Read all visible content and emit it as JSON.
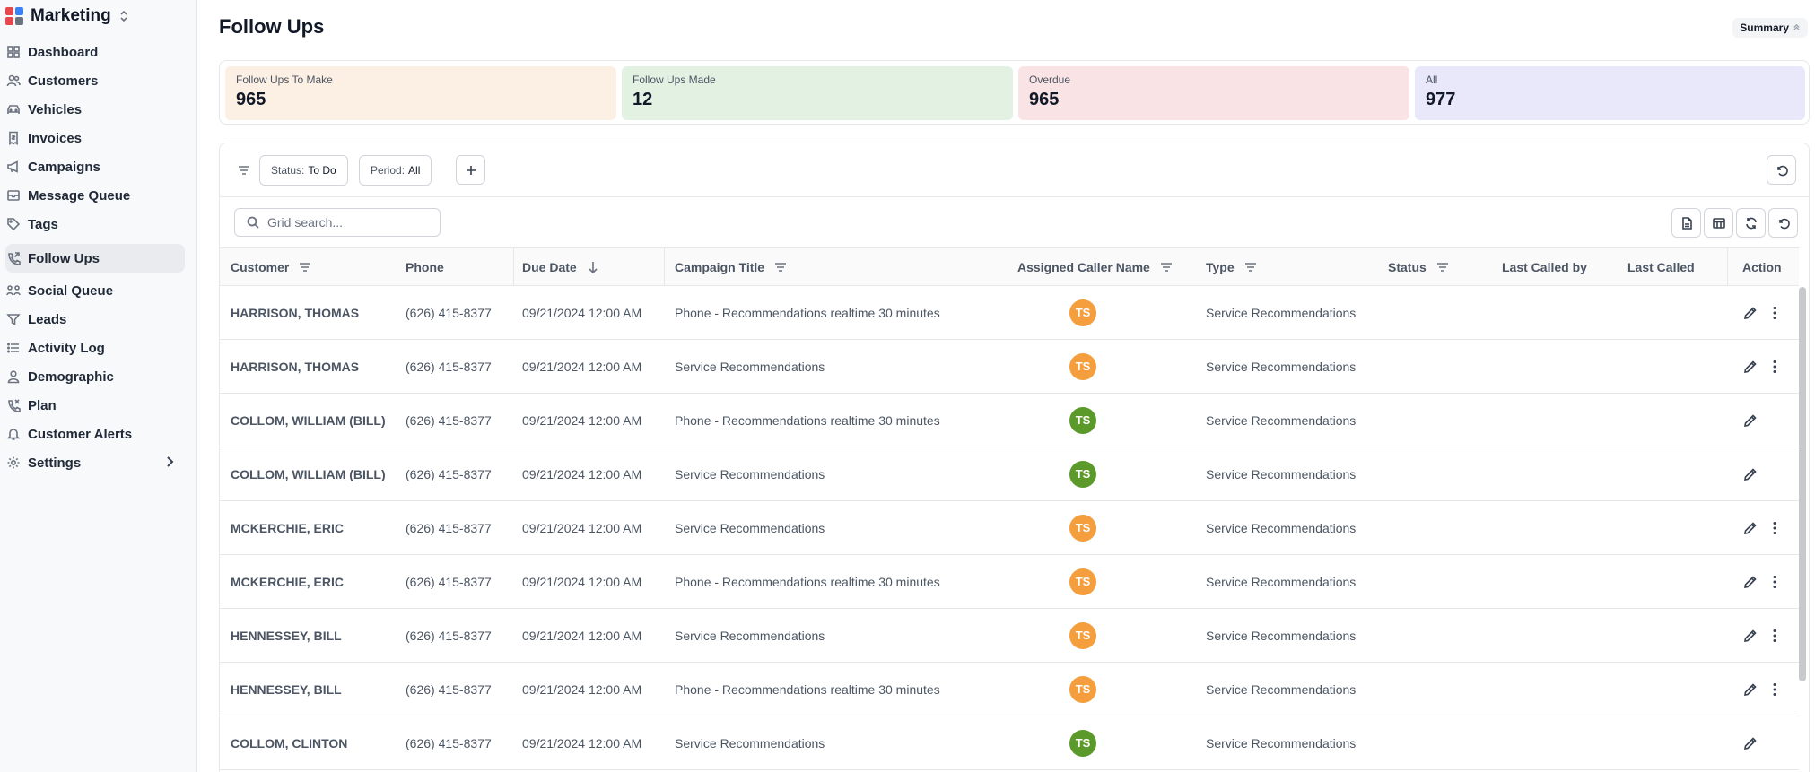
{
  "app": {
    "title": "Marketing",
    "brand_colors": [
      "#e5484d",
      "#3b82f6",
      "#f59e0b",
      "#22c55e"
    ]
  },
  "sidebar": {
    "items": [
      {
        "label": "Dashboard",
        "icon": "dashboard-icon"
      },
      {
        "label": "Customers",
        "icon": "users-icon"
      },
      {
        "label": "Vehicles",
        "icon": "car-icon"
      },
      {
        "label": "Invoices",
        "icon": "invoice-icon"
      },
      {
        "label": "Campaigns",
        "icon": "megaphone-icon"
      },
      {
        "label": "Message Queue",
        "icon": "message-queue-icon"
      },
      {
        "label": "Tags",
        "icon": "tag-icon"
      },
      {
        "label": "Follow Ups",
        "icon": "follow-up-icon",
        "active": true
      },
      {
        "label": "Social Queue",
        "icon": "social-icon"
      },
      {
        "label": "Leads",
        "icon": "funnel-icon"
      },
      {
        "label": "Activity Log",
        "icon": "list-icon"
      },
      {
        "label": "Demographic",
        "icon": "person-icon"
      },
      {
        "label": "Plan",
        "icon": "plan-icon"
      },
      {
        "label": "Customer Alerts",
        "icon": "bell-icon"
      },
      {
        "label": "Settings",
        "icon": "gear-icon"
      }
    ]
  },
  "header": {
    "title": "Follow Ups",
    "summary_label": "Summary"
  },
  "stats": [
    {
      "label": "Follow Ups To Make",
      "value": "965",
      "color": "#fcefe3"
    },
    {
      "label": "Follow Ups Made",
      "value": "12",
      "color": "#e3f1e3"
    },
    {
      "label": "Overdue",
      "value": "965",
      "color": "#fae3e4"
    },
    {
      "label": "All",
      "value": "977",
      "color": "#e8e8fa"
    }
  ],
  "filters": {
    "status_key": "Status:",
    "status_value": "To Do",
    "period_key": "Period:",
    "period_value": "All"
  },
  "search": {
    "placeholder": "Grid search..."
  },
  "table": {
    "columns": {
      "customer": "Customer",
      "phone": "Phone",
      "due_date": "Due Date",
      "campaign": "Campaign Title",
      "caller": "Assigned Caller Name",
      "type": "Type",
      "status": "Status",
      "last_called_by": "Last Called by",
      "last_called": "Last Called",
      "action": "Action"
    },
    "rows": [
      {
        "customer": "HARRISON, THOMAS",
        "phone": "(626) 415-8377",
        "due": "09/21/2024 12:00 AM",
        "campaign": "Phone - Recommendations realtime 30 minutes",
        "caller": "TS",
        "caller_color": "#f59e3d",
        "type": "Service Recommendations",
        "status": "",
        "last_called_by": "",
        "last_called": "",
        "has_more": true
      },
      {
        "customer": "HARRISON, THOMAS",
        "phone": "(626) 415-8377",
        "due": "09/21/2024 12:00 AM",
        "campaign": "Service Recommendations",
        "caller": "TS",
        "caller_color": "#f59e3d",
        "type": "Service Recommendations",
        "status": "",
        "last_called_by": "",
        "last_called": "",
        "has_more": true
      },
      {
        "customer": "COLLOM, WILLIAM (BILL)",
        "phone": "(626) 415-8377",
        "due": "09/21/2024 12:00 AM",
        "campaign": "Phone - Recommendations realtime 30 minutes",
        "caller": "TS",
        "caller_color": "#5b9a2a",
        "type": "Service Recommendations",
        "status": "",
        "last_called_by": "",
        "last_called": "",
        "has_more": false
      },
      {
        "customer": "COLLOM, WILLIAM (BILL)",
        "phone": "(626) 415-8377",
        "due": "09/21/2024 12:00 AM",
        "campaign": "Service Recommendations",
        "caller": "TS",
        "caller_color": "#5b9a2a",
        "type": "Service Recommendations",
        "status": "",
        "last_called_by": "",
        "last_called": "",
        "has_more": false
      },
      {
        "customer": "MCKERCHIE, ERIC",
        "phone": "(626) 415-8377",
        "due": "09/21/2024 12:00 AM",
        "campaign": "Service Recommendations",
        "caller": "TS",
        "caller_color": "#f59e3d",
        "type": "Service Recommendations",
        "status": "",
        "last_called_by": "",
        "last_called": "",
        "has_more": true
      },
      {
        "customer": "MCKERCHIE, ERIC",
        "phone": "(626) 415-8377",
        "due": "09/21/2024 12:00 AM",
        "campaign": "Phone - Recommendations realtime 30 minutes",
        "caller": "TS",
        "caller_color": "#f59e3d",
        "type": "Service Recommendations",
        "status": "",
        "last_called_by": "",
        "last_called": "",
        "has_more": true
      },
      {
        "customer": "HENNESSEY, BILL",
        "phone": "(626) 415-8377",
        "due": "09/21/2024 12:00 AM",
        "campaign": "Service Recommendations",
        "caller": "TS",
        "caller_color": "#f59e3d",
        "type": "Service Recommendations",
        "status": "",
        "last_called_by": "",
        "last_called": "",
        "has_more": true
      },
      {
        "customer": "HENNESSEY, BILL",
        "phone": "(626) 415-8377",
        "due": "09/21/2024 12:00 AM",
        "campaign": "Phone - Recommendations realtime 30 minutes",
        "caller": "TS",
        "caller_color": "#f59e3d",
        "type": "Service Recommendations",
        "status": "",
        "last_called_by": "",
        "last_called": "",
        "has_more": true
      },
      {
        "customer": "COLLOM, CLINTON",
        "phone": "(626) 415-8377",
        "due": "09/21/2024 12:00 AM",
        "campaign": "Service Recommendations",
        "caller": "TS",
        "caller_color": "#5b9a2a",
        "type": "Service Recommendations",
        "status": "",
        "last_called_by": "",
        "last_called": "",
        "has_more": false
      }
    ]
  }
}
